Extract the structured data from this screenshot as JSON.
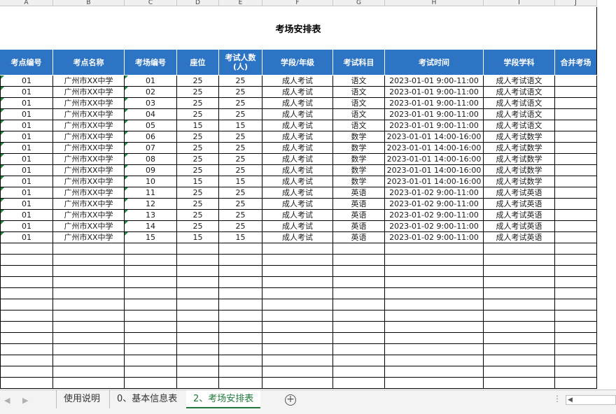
{
  "columns": [
    "A",
    "B",
    "C",
    "D",
    "E",
    "F",
    "G",
    "H",
    "I",
    "J"
  ],
  "sheet_title": "考场安排表",
  "headers": [
    "考点编号",
    "考点名称",
    "考场编号",
    "座位",
    "考试人数\n(人)",
    "学段/年级",
    "考试科目",
    "考试时间",
    "学段学科",
    "合并考场"
  ],
  "rows": [
    [
      "01",
      "广州市XX中学",
      "01",
      "25",
      "25",
      "成人考试",
      "语文",
      "2023-01-01 9:00-11:00",
      "成人考试语文",
      ""
    ],
    [
      "01",
      "广州市XX中学",
      "02",
      "25",
      "25",
      "成人考试",
      "语文",
      "2023-01-01 9:00-11:00",
      "成人考试语文",
      ""
    ],
    [
      "01",
      "广州市XX中学",
      "03",
      "25",
      "25",
      "成人考试",
      "语文",
      "2023-01-01 9:00-11:00",
      "成人考试语文",
      ""
    ],
    [
      "01",
      "广州市XX中学",
      "04",
      "25",
      "25",
      "成人考试",
      "语文",
      "2023-01-01 9:00-11:00",
      "成人考试语文",
      ""
    ],
    [
      "01",
      "广州市XX中学",
      "05",
      "15",
      "15",
      "成人考试",
      "语文",
      "2023-01-01 9:00-11:00",
      "成人考试语文",
      ""
    ],
    [
      "01",
      "广州市XX中学",
      "06",
      "25",
      "25",
      "成人考试",
      "数学",
      "2023-01-01 14:00-16:00",
      "成人考试数学",
      ""
    ],
    [
      "01",
      "广州市XX中学",
      "07",
      "25",
      "25",
      "成人考试",
      "数学",
      "2023-01-01 14:00-16:00",
      "成人考试数学",
      ""
    ],
    [
      "01",
      "广州市XX中学",
      "08",
      "25",
      "25",
      "成人考试",
      "数学",
      "2023-01-01 14:00-16:00",
      "成人考试数学",
      ""
    ],
    [
      "01",
      "广州市XX中学",
      "09",
      "25",
      "25",
      "成人考试",
      "数学",
      "2023-01-01 14:00-16:00",
      "成人考试数学",
      ""
    ],
    [
      "01",
      "广州市XX中学",
      "10",
      "15",
      "15",
      "成人考试",
      "数学",
      "2023-01-01 14:00-16:00",
      "成人考试数学",
      ""
    ],
    [
      "01",
      "广州市XX中学",
      "11",
      "25",
      "25",
      "成人考试",
      "英语",
      "2023-01-02 9:00-11:00",
      "成人考试英语",
      ""
    ],
    [
      "01",
      "广州市XX中学",
      "12",
      "25",
      "25",
      "成人考试",
      "英语",
      "2023-01-02 9:00-11:00",
      "成人考试英语",
      ""
    ],
    [
      "01",
      "广州市XX中学",
      "13",
      "25",
      "25",
      "成人考试",
      "英语",
      "2023-01-02 9:00-11:00",
      "成人考试英语",
      ""
    ],
    [
      "01",
      "广州市XX中学",
      "14",
      "25",
      "25",
      "成人考试",
      "英语",
      "2023-01-02 9:00-11:00",
      "成人考试英语",
      ""
    ],
    [
      "01",
      "广州市XX中学",
      "15",
      "15",
      "15",
      "成人考试",
      "英语",
      "2023-01-02 9:00-11:00",
      "成人考试英语",
      ""
    ]
  ],
  "empty_rows": 13,
  "colors": {
    "header_bg": "#2e74c4",
    "active_tab": "#1e7a3c",
    "text_marker": "#1e8a3c"
  },
  "tabs": [
    {
      "label": "使用说明",
      "active": false
    },
    {
      "label": "0、基本信息表",
      "active": false
    },
    {
      "label": "2、考场安排表",
      "active": true
    }
  ],
  "tabbar": {
    "prev_icon": "◀",
    "next_icon": "▶",
    "add_icon": "+",
    "more_icon": "⋮",
    "scroll_left_icon": "◀"
  }
}
